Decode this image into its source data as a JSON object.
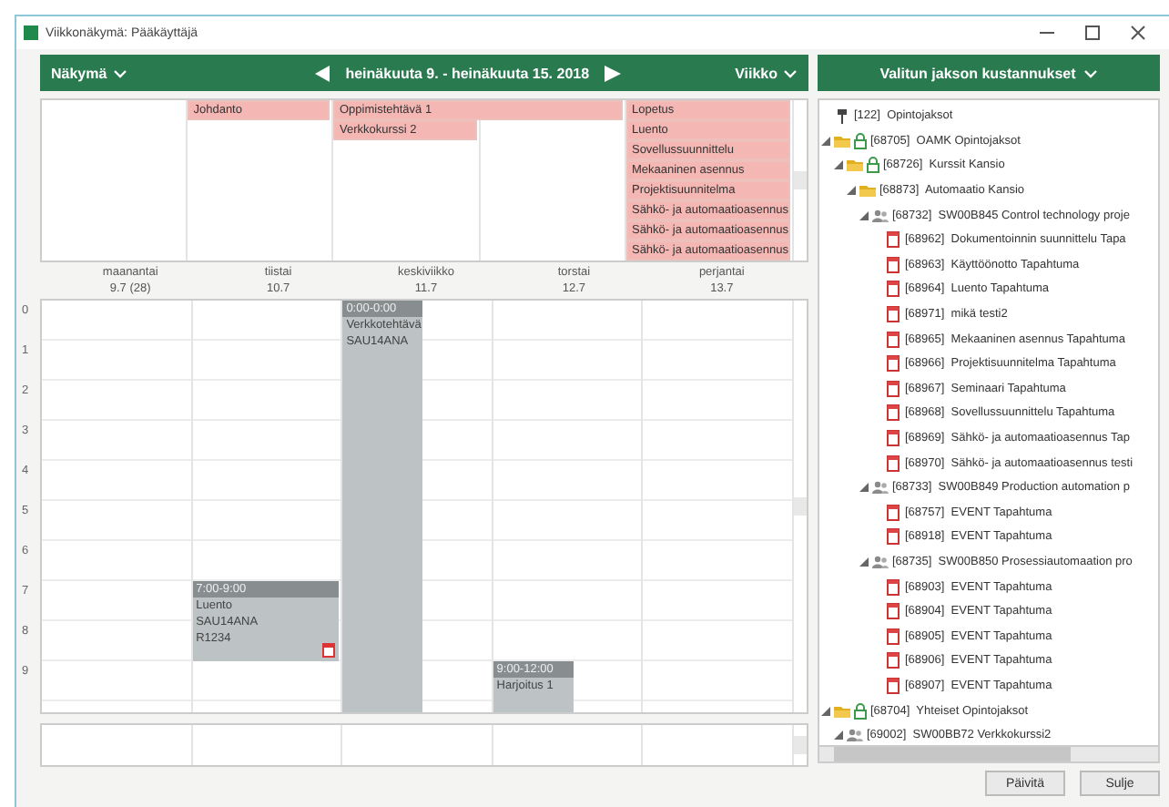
{
  "window": {
    "title": "Viikkonäkymä: Pääkäyttäjä"
  },
  "calendar": {
    "view_menu": "Näkymä",
    "range": "heinäkuuta 9. - heinäkuuta 15. 2018",
    "mode_menu": "Viikko",
    "days": [
      {
        "name": "maanantai",
        "date": "9.7 (28)"
      },
      {
        "name": "tiistai",
        "date": "10.7",
        "all_day": [
          {
            "title": "Johdanto",
            "continues": false
          }
        ],
        "events": [
          {
            "time": "7:00-9:00",
            "lines": [
              "Luento",
              "SAU14ANA",
              "R1234"
            ],
            "narrow": false,
            "has_note": true
          }
        ]
      },
      {
        "name": "keskiviikko",
        "date": "11.7",
        "all_day": [
          {
            "title": "Oppimistehtävä 1",
            "continues": true
          },
          {
            "title": "Verkkokurssi 2",
            "continues": false
          }
        ],
        "events": [
          {
            "time": "0:00-0:00",
            "lines": [
              "Verkkotehtävä",
              "SAU14ANA"
            ],
            "narrow": true
          }
        ]
      },
      {
        "name": "torstai",
        "date": "12.7",
        "events": [
          {
            "time": "9:00-12:00",
            "lines": [
              "Harjoitus 1"
            ],
            "narrow": true
          }
        ]
      },
      {
        "name": "perjantai",
        "date": "13.7",
        "all_day": [
          {
            "title": "Lopetus",
            "continues": false
          },
          {
            "title": "Luento",
            "continues": false
          },
          {
            "title": "Sovellussuunnittelu",
            "continues": false
          },
          {
            "title": "Mekaaninen asennus",
            "continues": false
          },
          {
            "title": "Projektisuunnitelma",
            "continues": false
          },
          {
            "title": "Sähkö- ja automaatioasennus",
            "continues": false
          },
          {
            "title": "Sähkö- ja automaatioasennus",
            "continues": false
          },
          {
            "title": "Sähkö- ja automaatioasennus",
            "continues": false
          }
        ]
      }
    ],
    "hours": [
      "0",
      "1",
      "2",
      "3",
      "4",
      "5",
      "6",
      "7",
      "8",
      "9"
    ]
  },
  "costs": {
    "title": "Valitun jakson kustannukset",
    "tree": [
      {
        "label": "[122]  Opintojaksot",
        "kind": "root",
        "locked": false
      },
      {
        "label": "[68705]  OAMK Opintojaksot",
        "kind": "folder",
        "locked": true,
        "expanded": true,
        "children": [
          {
            "label": "[68726]  Kurssit Kansio",
            "kind": "folder",
            "locked": true,
            "expanded": true,
            "children": [
              {
                "label": "[68873]  Automaatio Kansio",
                "kind": "folder",
                "locked": false,
                "expanded": true,
                "children": [
                  {
                    "label": "[68732]  SW00B845 Control technology proje",
                    "kind": "project",
                    "locked": false,
                    "expanded": true,
                    "children": [
                      {
                        "label": "[68962]  Dokumentoinnin suunnittelu Tapa",
                        "kind": "event",
                        "locked": false
                      },
                      {
                        "label": "[68963]  Käyttöönotto Tapahtuma",
                        "kind": "event",
                        "locked": false
                      },
                      {
                        "label": "[68964]  Luento Tapahtuma",
                        "kind": "event",
                        "locked": false
                      },
                      {
                        "label": "[68971]  mikä testi2",
                        "kind": "event",
                        "locked": false
                      },
                      {
                        "label": "[68965]  Mekaaninen asennus Tapahtuma",
                        "kind": "event",
                        "locked": false
                      },
                      {
                        "label": "[68966]  Projektisuunnitelma Tapahtuma",
                        "kind": "event",
                        "locked": false
                      },
                      {
                        "label": "[68967]  Seminaari Tapahtuma",
                        "kind": "event",
                        "locked": false
                      },
                      {
                        "label": "[68968]  Sovellussuunnittelu Tapahtuma",
                        "kind": "event",
                        "locked": false
                      },
                      {
                        "label": "[68969]  Sähkö- ja automaatioasennus Tap",
                        "kind": "event",
                        "locked": false
                      },
                      {
                        "label": "[68970]  Sähkö- ja automaatioasennus testi",
                        "kind": "event",
                        "locked": false
                      }
                    ]
                  },
                  {
                    "label": "[68733]  SW00B849 Production automation p",
                    "kind": "project",
                    "locked": false,
                    "expanded": true,
                    "children": [
                      {
                        "label": "[68757]  EVENT Tapahtuma",
                        "kind": "event",
                        "locked": false
                      },
                      {
                        "label": "[68918]  EVENT Tapahtuma",
                        "kind": "event",
                        "locked": false
                      }
                    ]
                  },
                  {
                    "label": "[68735]  SW00B850 Prosessiautomaation pro",
                    "kind": "project",
                    "locked": false,
                    "expanded": true,
                    "children": [
                      {
                        "label": "[68903]  EVENT Tapahtuma",
                        "kind": "event",
                        "locked": false
                      },
                      {
                        "label": "[68904]  EVENT Tapahtuma",
                        "kind": "event",
                        "locked": false
                      },
                      {
                        "label": "[68905]  EVENT Tapahtuma",
                        "kind": "event",
                        "locked": false
                      },
                      {
                        "label": "[68906]  EVENT Tapahtuma",
                        "kind": "event",
                        "locked": false
                      },
                      {
                        "label": "[68907]  EVENT Tapahtuma",
                        "kind": "event",
                        "locked": false
                      }
                    ]
                  }
                ]
              }
            ]
          }
        ]
      },
      {
        "label": "[68704]  Yhteiset Opintojaksot",
        "kind": "folder",
        "locked": true,
        "expanded": true,
        "children": [
          {
            "label": "[69002]  SW00BB72 Verkkokurssi2",
            "kind": "project",
            "locked": false,
            "expanded": true
          }
        ]
      }
    ]
  },
  "buttons": [
    "Päivitä",
    "Sulje"
  ]
}
